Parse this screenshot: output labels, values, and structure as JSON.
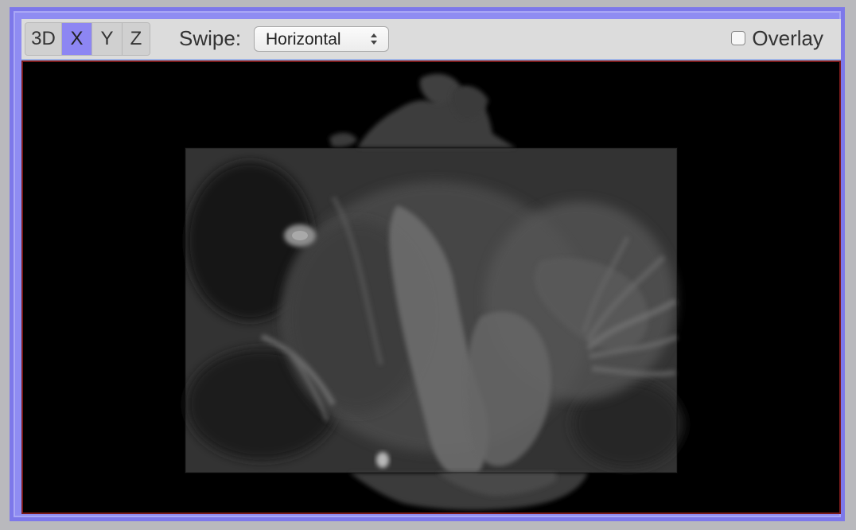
{
  "toolbar": {
    "views": [
      {
        "label": "3D",
        "active": false
      },
      {
        "label": "X",
        "active": true
      },
      {
        "label": "Y",
        "active": false
      },
      {
        "label": "Z",
        "active": false
      }
    ],
    "swipe_label": "Swipe:",
    "swipe_value": "Horizontal",
    "overlay_label": "Overlay",
    "overlay_checked": false
  },
  "colors": {
    "frame_border": "#7d78ea",
    "active_view": "#8d86f3",
    "viewer_bg": "#000000"
  }
}
